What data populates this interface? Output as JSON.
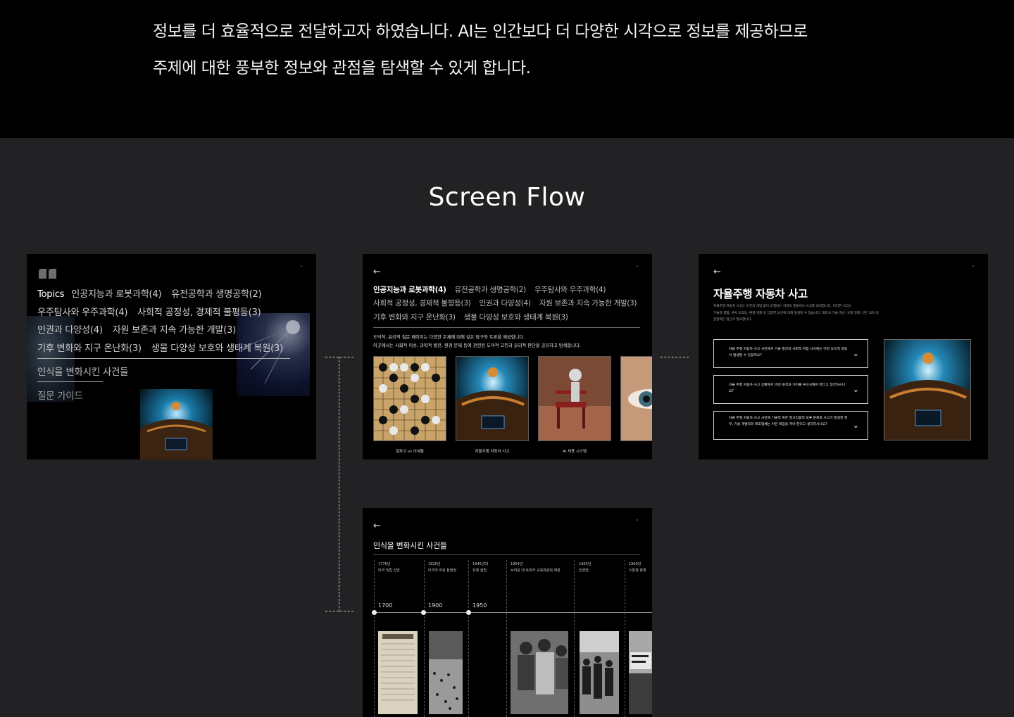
{
  "intro": {
    "line1": "정보를 더 효율적으로 전달하고자 하였습니다. AI는 인간보다 더 다양한 시각으로 정보를 제공하므로",
    "line2": "주제에 대한 풍부한 정보와 관점을 탐색할 수 있게 합니다."
  },
  "section_title": "Screen Flow",
  "screen1": {
    "topics_label": "Topics",
    "topics": [
      "인공지능과 로봇과학(4)",
      "유전공학과 생명공학(2)",
      "우주탐사와 우주과학(4)",
      "사회적 공정성, 경제적 불평등(3)",
      "인권과 다양성(4)",
      "자원 보존과 지속 가능한 개발(3)",
      "기후 변화와 지구 온난화(3)",
      "생물 다양성 보호와 생태계 복원(3)"
    ],
    "menu_events": "인식을 변화시킨 사건들",
    "menu_guide": "질문 가이드"
  },
  "screen2": {
    "back": "←",
    "topics": [
      "인공지능과 로봇과학(4)",
      "유전공학과 생명공학(2)",
      "우주탐사와 우주과학(4)",
      "사회적 공정성, 경제적 불평등(3)",
      "인권과 다양성(4)",
      "자원 보존과 지속 가능한 개발(3)",
      "기후 변화와 지구 온난화(3)",
      "생물 다양성 보호와 생태계 복원(3)"
    ],
    "desc1": "도덕적, 윤리적 질문 페이지는 다양한 주제에 대해 깊은 탐구와 토론을 제공합니다.",
    "desc2": "이곳에서는 사회적 이슈, 과학적 발전, 환경 문제 등에 관련된 도덕적 고민과 윤리적 판단을 공유하고 탐색합니다.",
    "cards": [
      "알파고 vs 이세돌",
      "자율주행 자동차 사고",
      "AI 채용 시스템",
      "딥"
    ]
  },
  "screen3": {
    "back": "←",
    "title": "자율주행 자동차 사고",
    "sub1": "자율주행 자동차 사고는 운전자 개입 없이 운행되는 차량의 충돌이나 사고를 의미합니다. 이러한 사고는",
    "sub2": "기술적 결함, 센서 오작동, 환경 변화 등 다양한 요인에 의해 발생할 수 있습니다. 따라서 기술 개선, 규제 강화, 안전 교육 등",
    "sub3": "종합적인 접근이 필요합니다.",
    "questions": [
      "자율 주행 자동차 사고 사안에서 기술 발전과 사회적 위험 사이에는 어떤 도덕적 갈등이 발생할 수 있을까요?",
      "자율 주행 자동차 사고 상황에서 어떤 원칙과 가치를 우선시해야 한다고 생각하시나요?",
      "자율 주행 자동차 사고 사안에 기술적 혹은 알고리즘적 오류 문제로 사고가 발생한 경우, 기술 개발자와 제조업체는 어떤 책임을 져야 한다고 생각하시나요?"
    ]
  },
  "screen4": {
    "back": "←",
    "title": "인식을 변화시킨 사건들",
    "events": [
      {
        "year": "1776년",
        "name": "미국 독립 선언"
      },
      {
        "year": "1920년",
        "name": "미국의 여성 참정권"
      },
      {
        "year": "1945년대",
        "name": "유엔 설립"
      },
      {
        "year": "1954년",
        "name": "브라운 대 토피카 교육위원회 재판"
      },
      {
        "year": "1965년",
        "name": "민권법"
      },
      {
        "year": "1969년",
        "name": "스톤월 항쟁"
      }
    ],
    "ticks": [
      "1700",
      "1900",
      "1950"
    ]
  }
}
